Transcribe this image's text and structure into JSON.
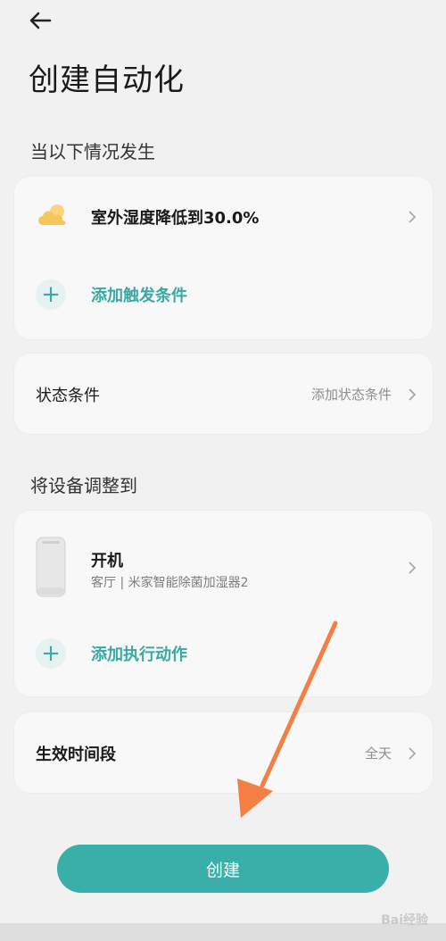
{
  "header": {
    "title": "创建自动化"
  },
  "sections": {
    "trigger_title": "当以下情况发生",
    "action_title": "将设备调整到"
  },
  "trigger_card": {
    "condition_label": "室外湿度降低到30.0%",
    "add_label": "添加触发条件"
  },
  "state_card": {
    "label": "状态条件",
    "value": "添加状态条件"
  },
  "action_card": {
    "action_label": "开机",
    "device_detail": "客厅 | 米家智能除菌加湿器2",
    "add_label": "添加执行动作"
  },
  "time_card": {
    "label": "生效时间段",
    "value": "全天"
  },
  "footer": {
    "create_label": "创建"
  },
  "watermark": "Bai经验",
  "colors": {
    "accent": "#3aaea9",
    "background": "#f1f1f1",
    "card": "#f8f8f8",
    "arrow": "#f47f45"
  }
}
